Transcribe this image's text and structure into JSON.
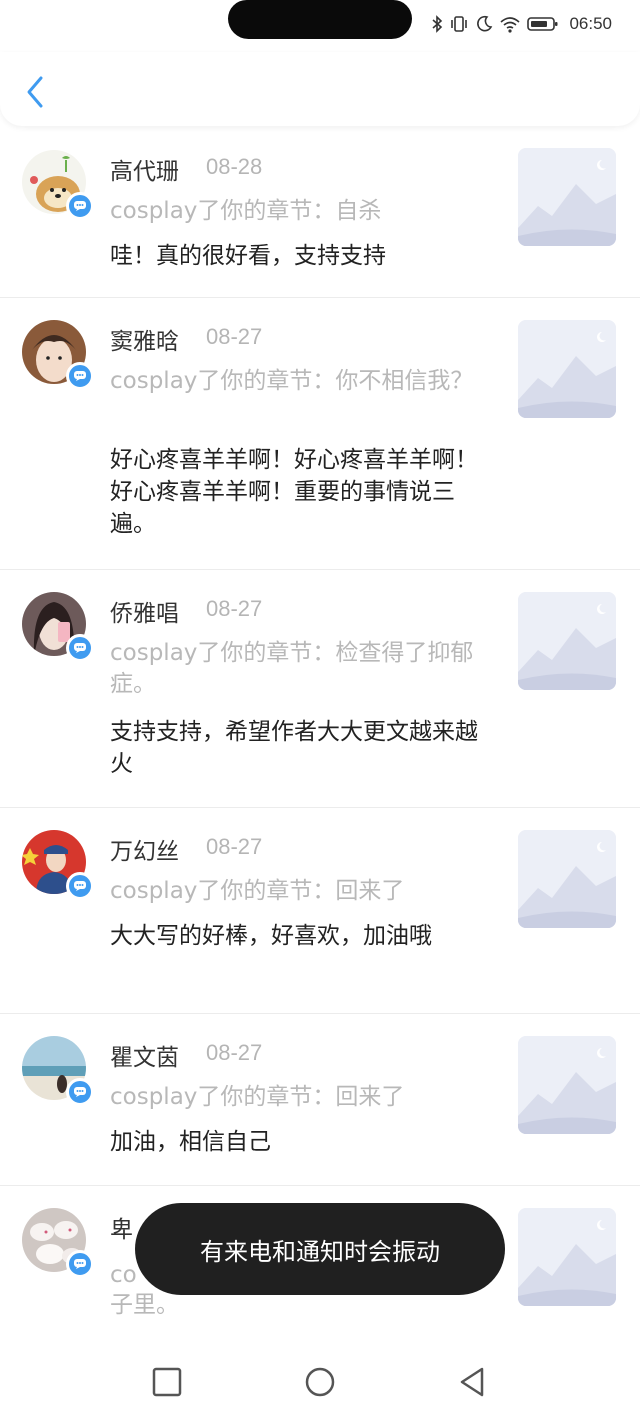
{
  "status_bar": {
    "time": "06:50"
  },
  "notifications": [
    {
      "name": "高代珊",
      "date": "08-28",
      "action": "cosplay了你的章节：自杀",
      "comment": "哇！真的很好看，支持支持",
      "avatar": "avatar-doge"
    },
    {
      "name": "窦雅晗",
      "date": "08-27",
      "action": "cosplay了你的章节：你不相信我？",
      "comment": "好心疼喜羊羊啊！好心疼喜羊羊啊！好心疼喜羊羊啊！重要的事情说三遍。",
      "avatar": "avatar-boy"
    },
    {
      "name": "侨雅唱",
      "date": "08-27",
      "action": "cosplay了你的章节：检查得了抑郁症。",
      "comment": "支持支持，希望作者大大更文越来越火",
      "avatar": "avatar-girl"
    },
    {
      "name": "万幻丝",
      "date": "08-27",
      "action": "cosplay了你的章节：回来了",
      "comment": "大大写的好棒，好喜欢，加油哦",
      "avatar": "avatar-soldier"
    },
    {
      "name": "瞿文茵",
      "date": "08-27",
      "action": "cosplay了你的章节：回来了",
      "comment": "加油，相信自己",
      "avatar": "avatar-beach"
    },
    {
      "name": "卑",
      "date": "",
      "action": "co",
      "action_line2": "子里。",
      "comment": "",
      "avatar": "avatar-rabbits"
    }
  ],
  "toast": {
    "text": "有来电和通知时会振动"
  },
  "colors": {
    "accent": "#3f9bf0",
    "toast_bg": "#202020",
    "muted_text": "#b8b8b8"
  }
}
